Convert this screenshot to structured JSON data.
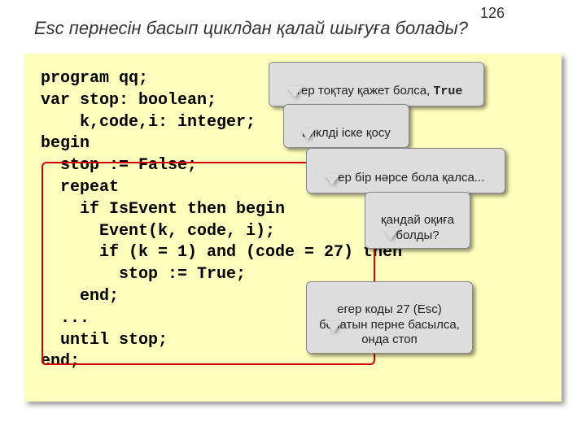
{
  "page": {
    "number": "126",
    "title": "Esc пернесін басып циклдан қалай шығуға болады?"
  },
  "code": {
    "l1": "program qq;",
    "l2": "var stop: boolean;",
    "l3": "    k,code,i: integer;",
    "l4": "begin",
    "l5": "  stop := False;",
    "l6": "  repeat",
    "l7": "    if IsEvent then begin",
    "l8": "      Event(k, code, i);",
    "l9": "      if (k = 1) and (code = 27) then",
    "l10": "        stop := True;",
    "l11": "    end;",
    "l12": "  ...",
    "l13": "  until stop;",
    "l14": "end;"
  },
  "callouts": {
    "c1_prefix": "егер тоқтау қажет болса, ",
    "c1_mono": "True",
    "c2": "циклді іске қосу",
    "c3": "егер бір нәрсе бола қалса...",
    "c4": "қандай оқиға болды?",
    "c5": "егер коды 27 (Esc) болатын перне басылса, онда стоп"
  }
}
